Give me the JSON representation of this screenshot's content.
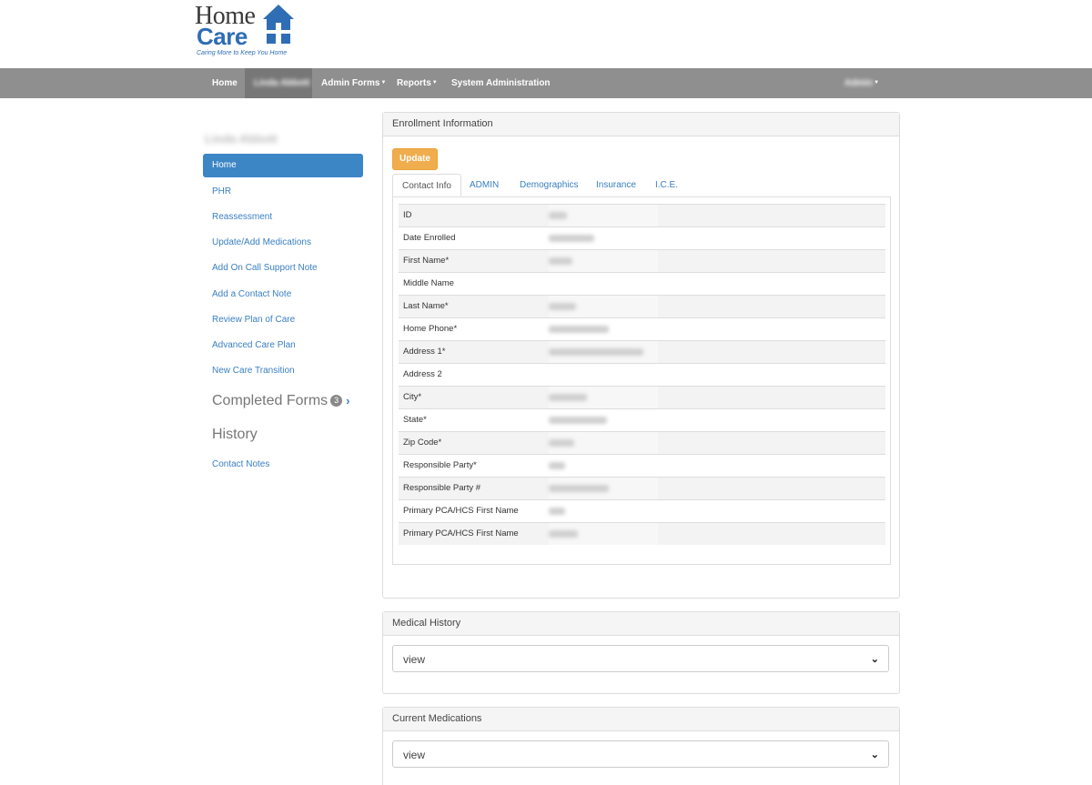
{
  "logo": {
    "line1": "Home",
    "line2": "Care",
    "tagline": "Caring More to Keep You Home"
  },
  "nav": {
    "home": "Home",
    "patient": "Linda Abbott",
    "admin_forms": "Admin Forms",
    "reports": "Reports",
    "system_admin": "System Administration",
    "user": "Admin"
  },
  "sidebar": {
    "patient_name": "Linda Abbott",
    "items": [
      {
        "label": "Home"
      },
      {
        "label": "PHR"
      },
      {
        "label": "Reassessment"
      },
      {
        "label": "Update/Add Medications"
      },
      {
        "label": "Add On Call Support Note"
      },
      {
        "label": "Add a Contact Note"
      },
      {
        "label": "Review Plan of Care"
      },
      {
        "label": "Advanced Care Plan"
      },
      {
        "label": "New Care Transition"
      }
    ],
    "completed_forms": "Completed Forms",
    "completed_count": "3",
    "history": "History",
    "contact_notes": "Contact Notes"
  },
  "enrollment": {
    "title": "Enrollment Information",
    "update_button": "Update",
    "tabs": [
      "Contact Info",
      "ADMIN",
      "Demographics",
      "Insurance",
      "I.C.E."
    ],
    "fields": [
      "ID",
      "Date Enrolled",
      "First Name*",
      "Middle Name",
      "Last Name*",
      "Home Phone*",
      "Address 1*",
      "Address 2",
      "City*",
      "State*",
      "Zip Code*",
      "Responsible Party*",
      "Responsible Party #",
      "Primary PCA/HCS First Name",
      "Primary PCA/HCS First Name"
    ]
  },
  "medical_history": {
    "title": "Medical History",
    "select_value": "view"
  },
  "current_medications": {
    "title": "Current Medications",
    "select_value": "view"
  },
  "colors": {
    "nav_bg": "#8f8f8f",
    "primary": "#3d86c6",
    "link": "#3a7fc1",
    "warning": "#f0ad4e"
  },
  "icons": {
    "dropdown": "chevron-down-icon",
    "completed": "chevron-right-icon",
    "logo": "house-icon"
  }
}
